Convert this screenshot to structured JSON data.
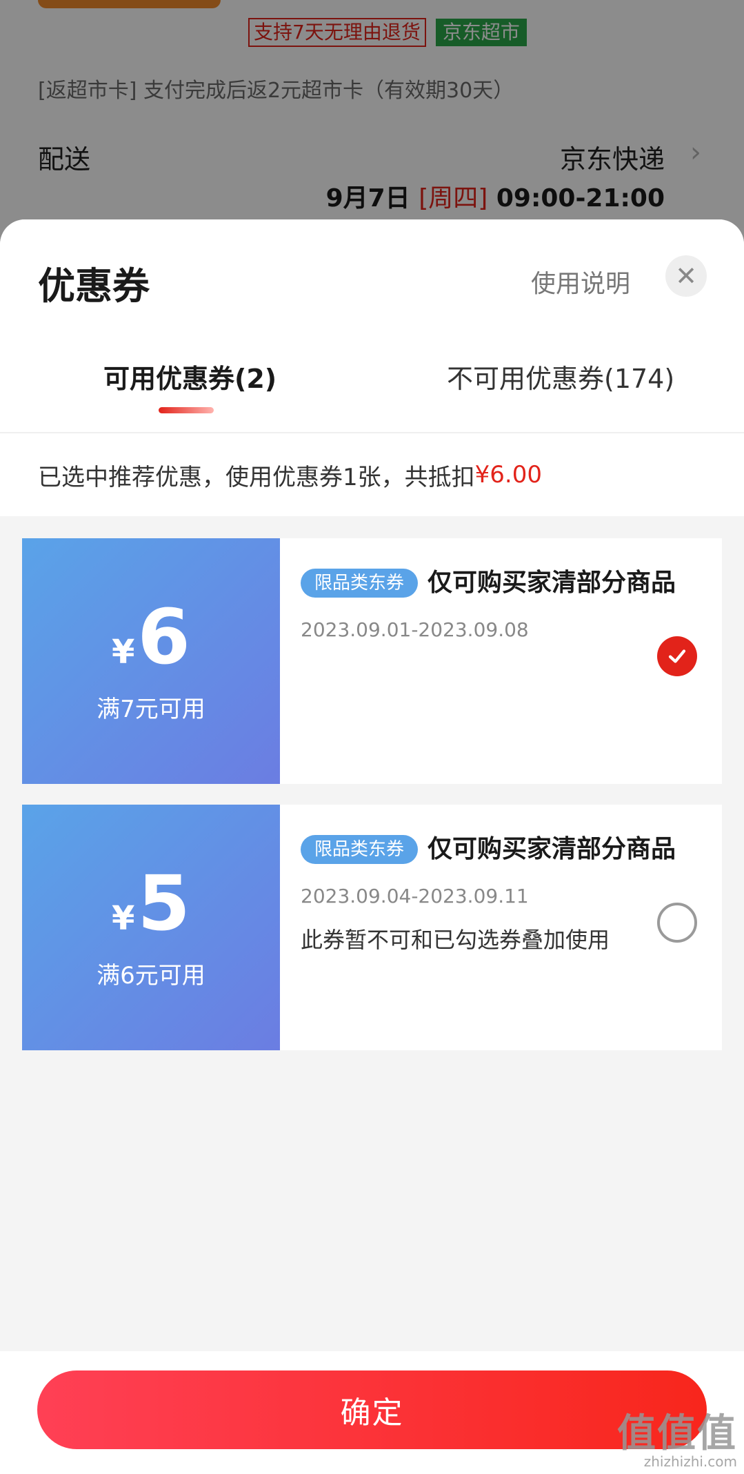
{
  "background": {
    "tag_return": "支持7天无理由退货",
    "tag_market": "京东超市",
    "rebate_text": "[返超市卡]  支付完成后返2元超市卡（有效期30天）",
    "delivery_label": "配送",
    "delivery_value": "京东快递",
    "delivery_date": "9月7日",
    "delivery_weekday": "[周四]",
    "delivery_time": "09:00-21:00"
  },
  "sheet": {
    "title": "优惠券",
    "help_link": "使用说明",
    "close_icon": "close-icon"
  },
  "tabs": [
    {
      "label": "可用优惠券(2)",
      "active": true
    },
    {
      "label": "不可用优惠券(174)",
      "active": false
    }
  ],
  "summary": {
    "text": "已选中推荐优惠，使用优惠券1张，共抵扣",
    "amount": "¥6.00"
  },
  "coupons": [
    {
      "currency": "¥",
      "value": "6",
      "threshold": "满7元可用",
      "badge": "限品类东券",
      "title": "仅可购买家清部分商品",
      "validity": "2023.09.01-2023.09.08",
      "note": "",
      "selected": true
    },
    {
      "currency": "¥",
      "value": "5",
      "threshold": "满6元可用",
      "badge": "限品类东券",
      "title": "仅可购买家清部分商品",
      "validity": "2023.09.04-2023.09.11",
      "note": "此券暂不可和已勾选券叠加使用",
      "selected": false
    }
  ],
  "footer": {
    "confirm_label": "确定"
  },
  "watermark": {
    "big": "值值值",
    "small": "zhizhizhi.com"
  },
  "colors": {
    "accent_red": "#e2231a",
    "coupon_blue": "#5aa3e8",
    "coupon_purple": "#6b7de2",
    "market_green": "#2aa84a"
  }
}
